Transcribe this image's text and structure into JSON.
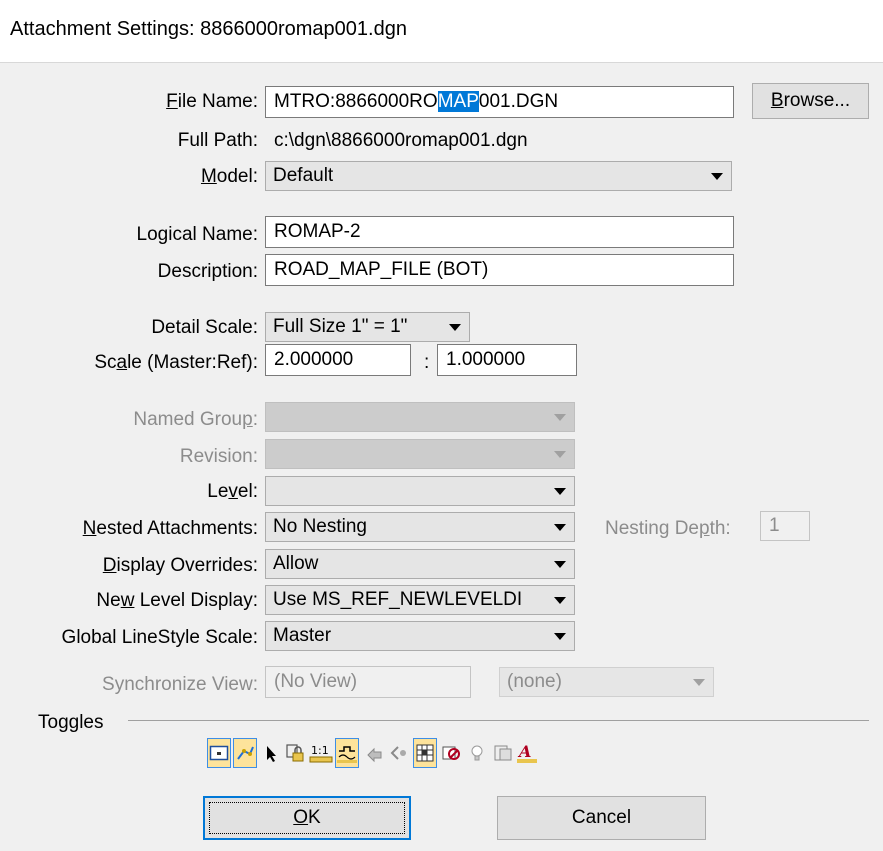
{
  "window": {
    "title": "Attachment Settings: 8866000romap001.dgn"
  },
  "file_name": {
    "label_hotkey": "F",
    "label_rest": "ile Name:",
    "value_before": "MTRO:8866000RO",
    "value_selected": "MAP",
    "value_after": "001.DGN"
  },
  "browse": {
    "label_hotkey": "B",
    "label_rest": "rowse..."
  },
  "full_path": {
    "label": "Full Path:",
    "value": "c:\\dgn\\8866000romap001.dgn"
  },
  "model": {
    "label_hotkey": "M",
    "label_rest": "odel:",
    "value": "Default"
  },
  "logical_name": {
    "label": "Logical Name:",
    "value": "ROMAP-2"
  },
  "description": {
    "label": "Description:",
    "value": "ROAD_MAP_FILE (BOT)"
  },
  "detail_scale": {
    "label": "Detail Scale:",
    "value": "Full Size 1\" = 1\""
  },
  "scale": {
    "label_pre": "Sc",
    "label_hotkey": "a",
    "label_post": "le (Master:Ref):",
    "master": "2.000000",
    "separator": ":",
    "ref": "1.000000"
  },
  "named_group": {
    "label_pre": "Named Grou",
    "label_hotkey": "p",
    "label_post": ":",
    "value": ""
  },
  "revision": {
    "label": "Revision:",
    "value": ""
  },
  "level": {
    "label_pre": "Le",
    "label_hotkey": "v",
    "label_post": "el:",
    "value": ""
  },
  "nested_attachments": {
    "label_hotkey": "N",
    "label_rest": "ested Attachments:",
    "value": "No Nesting"
  },
  "nesting_depth": {
    "label_pre": "Nesting De",
    "label_hotkey": "p",
    "label_post": "th:",
    "value": "1"
  },
  "display_overrides": {
    "label_hotkey": "D",
    "label_rest": "isplay Overrides:",
    "value": "Allow"
  },
  "new_level_display": {
    "label_pre": "Ne",
    "label_hotkey": "w",
    "label_post": " Level Display:",
    "value": "Use MS_REF_NEWLEVELDI"
  },
  "global_linestyle_scale": {
    "label": "Global LineStyle Scale:",
    "value": "Master"
  },
  "synchronize_view": {
    "label": "Synchronize View:",
    "value": "(No View)",
    "option": "(none)"
  },
  "toggles": {
    "label": "Toggles",
    "items": [
      {
        "icon": "display-toggle-icon",
        "on": true
      },
      {
        "icon": "snap-toggle-icon",
        "on": true
      },
      {
        "icon": "locate-toggle-icon",
        "on": false
      },
      {
        "icon": "lock-toggle-icon",
        "on": false
      },
      {
        "icon": "true-scale-toggle-icon",
        "on": false,
        "text": "1:1"
      },
      {
        "icon": "scale-linestyles-toggle-icon",
        "on": true
      },
      {
        "icon": "ignore-attachment-when-live-nesting-icon",
        "on": false
      },
      {
        "icon": "treat-as-element-icon",
        "on": false
      },
      {
        "icon": "display-raster-references-icon",
        "on": true
      },
      {
        "icon": "use-lights-icon",
        "on": false
      },
      {
        "icon": "light-bulb-icon",
        "on": false
      },
      {
        "icon": "annotation-scale-icon",
        "on": false
      },
      {
        "icon": "text-scale-icon",
        "on": false,
        "text": "A"
      }
    ]
  },
  "ok": {
    "label_hotkey": "O",
    "label_rest": "K"
  },
  "cancel": {
    "label": "Cancel"
  },
  "colors": {
    "accent": "#0078d7",
    "toggle_on": "#fde39b",
    "disabled_text": "#8c8c8c"
  }
}
